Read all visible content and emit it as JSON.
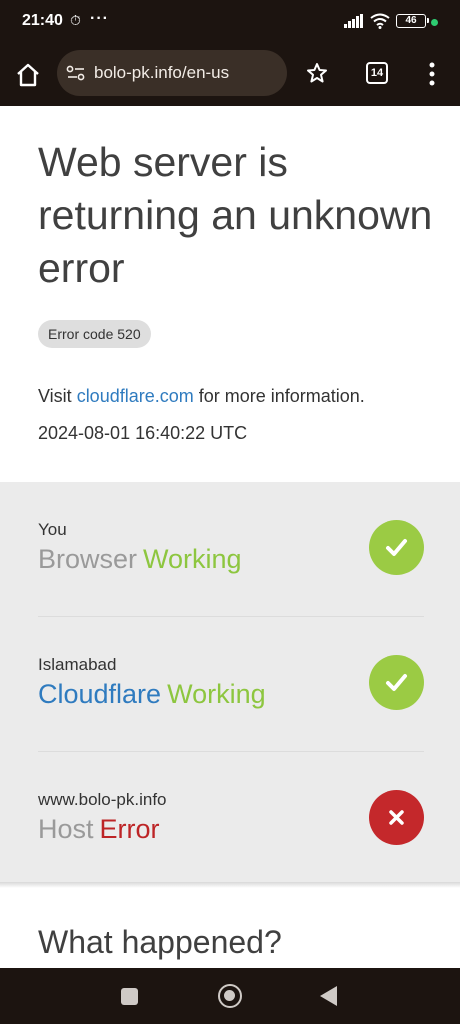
{
  "status_bar": {
    "time": "21:40",
    "more": "···",
    "battery": "46",
    "icons": [
      "timer-icon",
      "signal-icon",
      "wifi-icon",
      "battery-icon",
      "privacy-dot-icon"
    ]
  },
  "toolbar": {
    "url": "bolo-pk.info/en-us",
    "tab_count": "14",
    "icons": [
      "home-icon",
      "site-settings-icon",
      "star-icon",
      "tabs-icon",
      "overflow-menu-icon"
    ]
  },
  "page": {
    "headline": "Web server is returning an unknown error",
    "error_code": "Error code 520",
    "visit_prefix": "Visit ",
    "visit_link": "cloudflare.com",
    "visit_suffix": " for more information.",
    "timestamp": "2024-08-01 16:40:22 UTC",
    "status_rows": [
      {
        "location": "You",
        "name": "Browser",
        "status": "Working",
        "state": "ok"
      },
      {
        "location": "Islamabad",
        "name": "Cloudflare",
        "status": "Working",
        "state": "ok"
      },
      {
        "location": "www.bolo-pk.info",
        "name": "Host",
        "status": "Error",
        "state": "error"
      }
    ],
    "what_happened": "What happened?"
  },
  "colors": {
    "working": "#8dc63f",
    "error": "#bd2426",
    "link": "#2f7bbf",
    "chrome_bg": "#1c1410"
  },
  "navbar": {
    "icons": [
      "recent-apps-icon",
      "home-button-icon",
      "back-icon"
    ]
  }
}
